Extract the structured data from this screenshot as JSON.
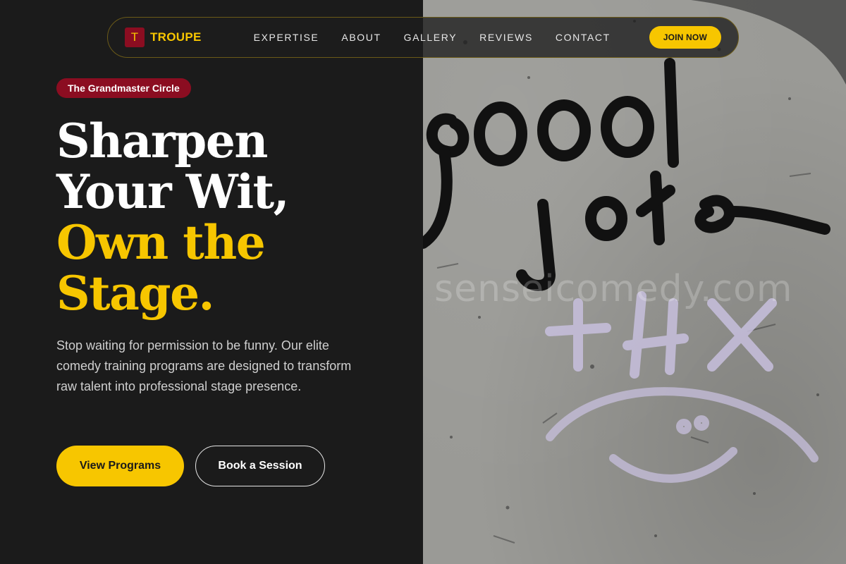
{
  "brand": {
    "logo_letter": "T",
    "name": "TROUPE"
  },
  "nav": {
    "links": [
      "EXPERTISE",
      "ABOUT",
      "GALLERY",
      "REVIEWS",
      "CONTACT"
    ],
    "cta_label": "JOIN NOW"
  },
  "hero": {
    "badge": "The Grandmaster Circle",
    "headline_white": [
      "Sharpen",
      "Your Wit,"
    ],
    "headline_yellow": [
      "Own the",
      "Stage."
    ],
    "subtext": "Stop waiting for permission to be funny. Our elite comedy training programs are designed to transform raw talent into professional stage presence.",
    "primary_button": "View Programs",
    "secondary_button": "Book a Session"
  },
  "image": {
    "watermark": "senseicomedy.com",
    "subject": "graffiti-wall"
  },
  "colors": {
    "accent_yellow": "#f7c600",
    "brand_red": "#8b0d21",
    "background": "#1b1b1b"
  }
}
